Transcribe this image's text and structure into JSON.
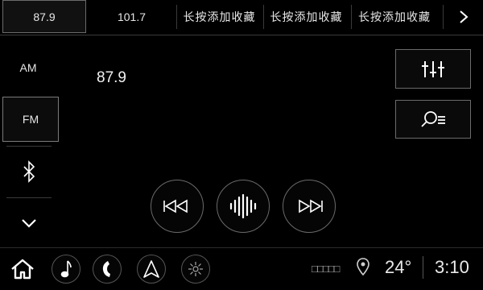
{
  "presets": [
    "87.9",
    "101.7",
    "长按添加收藏",
    "长按添加收藏",
    "长按添加收藏"
  ],
  "bands": {
    "am": "AM",
    "fm": "FM"
  },
  "current_frequency": "87.9",
  "status": {
    "signal_boxes": "□□□□□",
    "temperature": "24°",
    "time": "3:10"
  },
  "icons": {
    "next": "chevron-right-icon",
    "bluetooth": "bluetooth-icon",
    "expand": "chevron-down-icon",
    "equalizer": "equalizer-icon",
    "search": "search-list-icon",
    "prev": "previous-track-icon",
    "scan": "scan-waveform-icon",
    "skip": "next-track-icon",
    "home": "home-icon",
    "music": "music-note-icon",
    "phone": "phone-icon",
    "navigation": "navigation-icon",
    "climate": "climate-icon",
    "location": "location-pin-icon"
  },
  "colors": {
    "background": "#000000",
    "border": "#6b6b6b",
    "text": "#ffffff"
  }
}
